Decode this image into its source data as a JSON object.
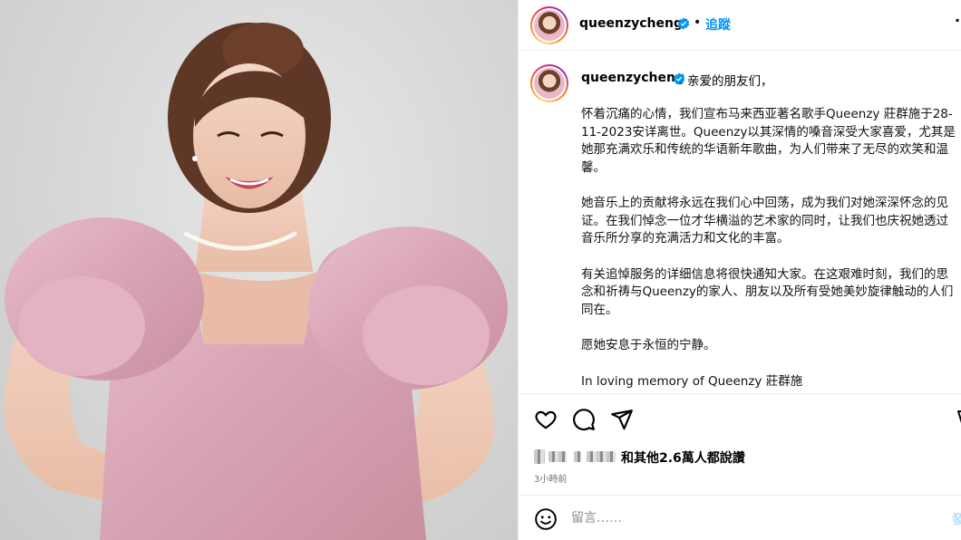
{
  "post": {
    "username": "queenzycheng",
    "follow_label": "追蹤",
    "separator": "•",
    "more_label": "···"
  },
  "caption": {
    "username": "queenzycheng",
    "greeting": "亲爱的朋友们，",
    "paragraphs": [
      "怀着沉痛的心情，我们宣布马来西亚著名歌手Queenzy 莊群施于28-11-2023安详离世。Queenzy以其深情的嗓音深受大家喜爱，尤其是她那充满欢乐和传统的华语新年歌曲，为人们带来了无尽的欢笑和温馨。",
      "她音乐上的贡献将永远在我们心中回荡，成为我们对她深深怀念的见证。在我们悼念一位才华横溢的艺术家的同时，让我们也庆祝她透过音乐所分享的充满活力和文化的丰富。",
      "有关追悼服务的详细信息将很快通知大家。在这艰难时刻，我们的思念和祈祷与Queenzy的家人、朋友以及所有受她美妙旋律触动的人们同在。",
      "愿她安息于永恒的宁静。",
      "In loving memory of Queenzy 莊群施"
    ]
  },
  "engagement": {
    "likes_text": "和其他2.6萬人都說讚",
    "timestamp": "3小時前"
  },
  "comment_box": {
    "placeholder": "留言……",
    "post_label": "發"
  },
  "icons": {
    "verified": "verified-badge-icon",
    "like": "heart-icon",
    "comment": "comment-bubble-icon",
    "share": "paper-plane-icon",
    "save": "bookmark-icon",
    "emoji": "smiley-icon"
  },
  "colors": {
    "follow_blue": "#0095f6",
    "verified_blue": "#0095f6",
    "dress_pink": "#dcaab9",
    "background_gray": "#d9dad9"
  }
}
